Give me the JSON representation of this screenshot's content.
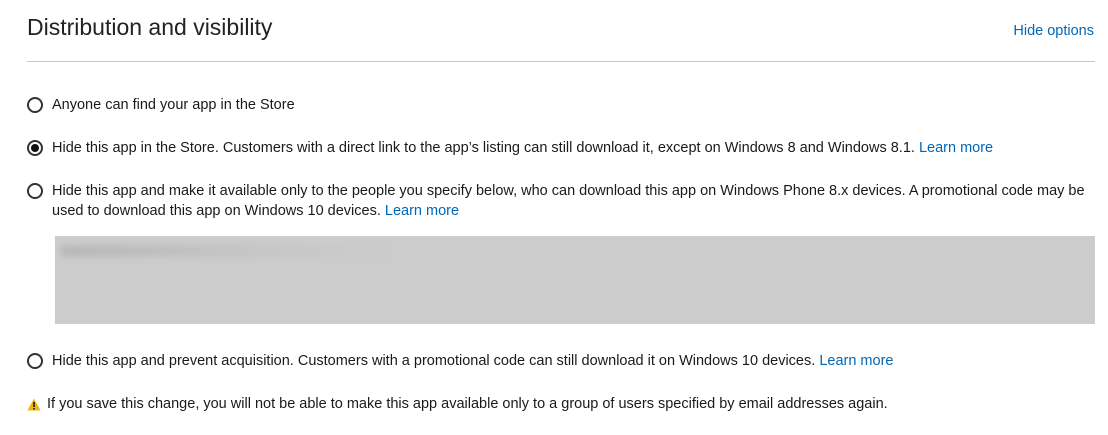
{
  "section": {
    "title": "Distribution and visibility",
    "hide_options_label": "Hide options"
  },
  "options": [
    {
      "label": "Anyone can find your app in the Store",
      "selected": false,
      "link": ""
    },
    {
      "label": "Hide this app in the Store. Customers with a direct link to the app’s listing can still download it, except on Windows 8 and Windows 8.1.",
      "selected": true,
      "link": "Learn more"
    },
    {
      "label": "Hide this app and make it available only to the people you specify below, who can download this app on Windows Phone 8.x devices. A promotional code may be used to download this app on Windows 10 devices.",
      "selected": false,
      "link": "Learn more"
    },
    {
      "label": "Hide this app and prevent acquisition. Customers with a promotional code can still download it on Windows 10 devices.",
      "selected": false,
      "link": "Learn more"
    }
  ],
  "warning": {
    "text": "If you save this change, you will not be able to make this app available only to a group of users specified by email addresses again.",
    "icon": "warning-icon",
    "icon_color": "#f2b705"
  },
  "colors": {
    "link": "#0067b8",
    "email_box_bg": "#cccccc"
  }
}
